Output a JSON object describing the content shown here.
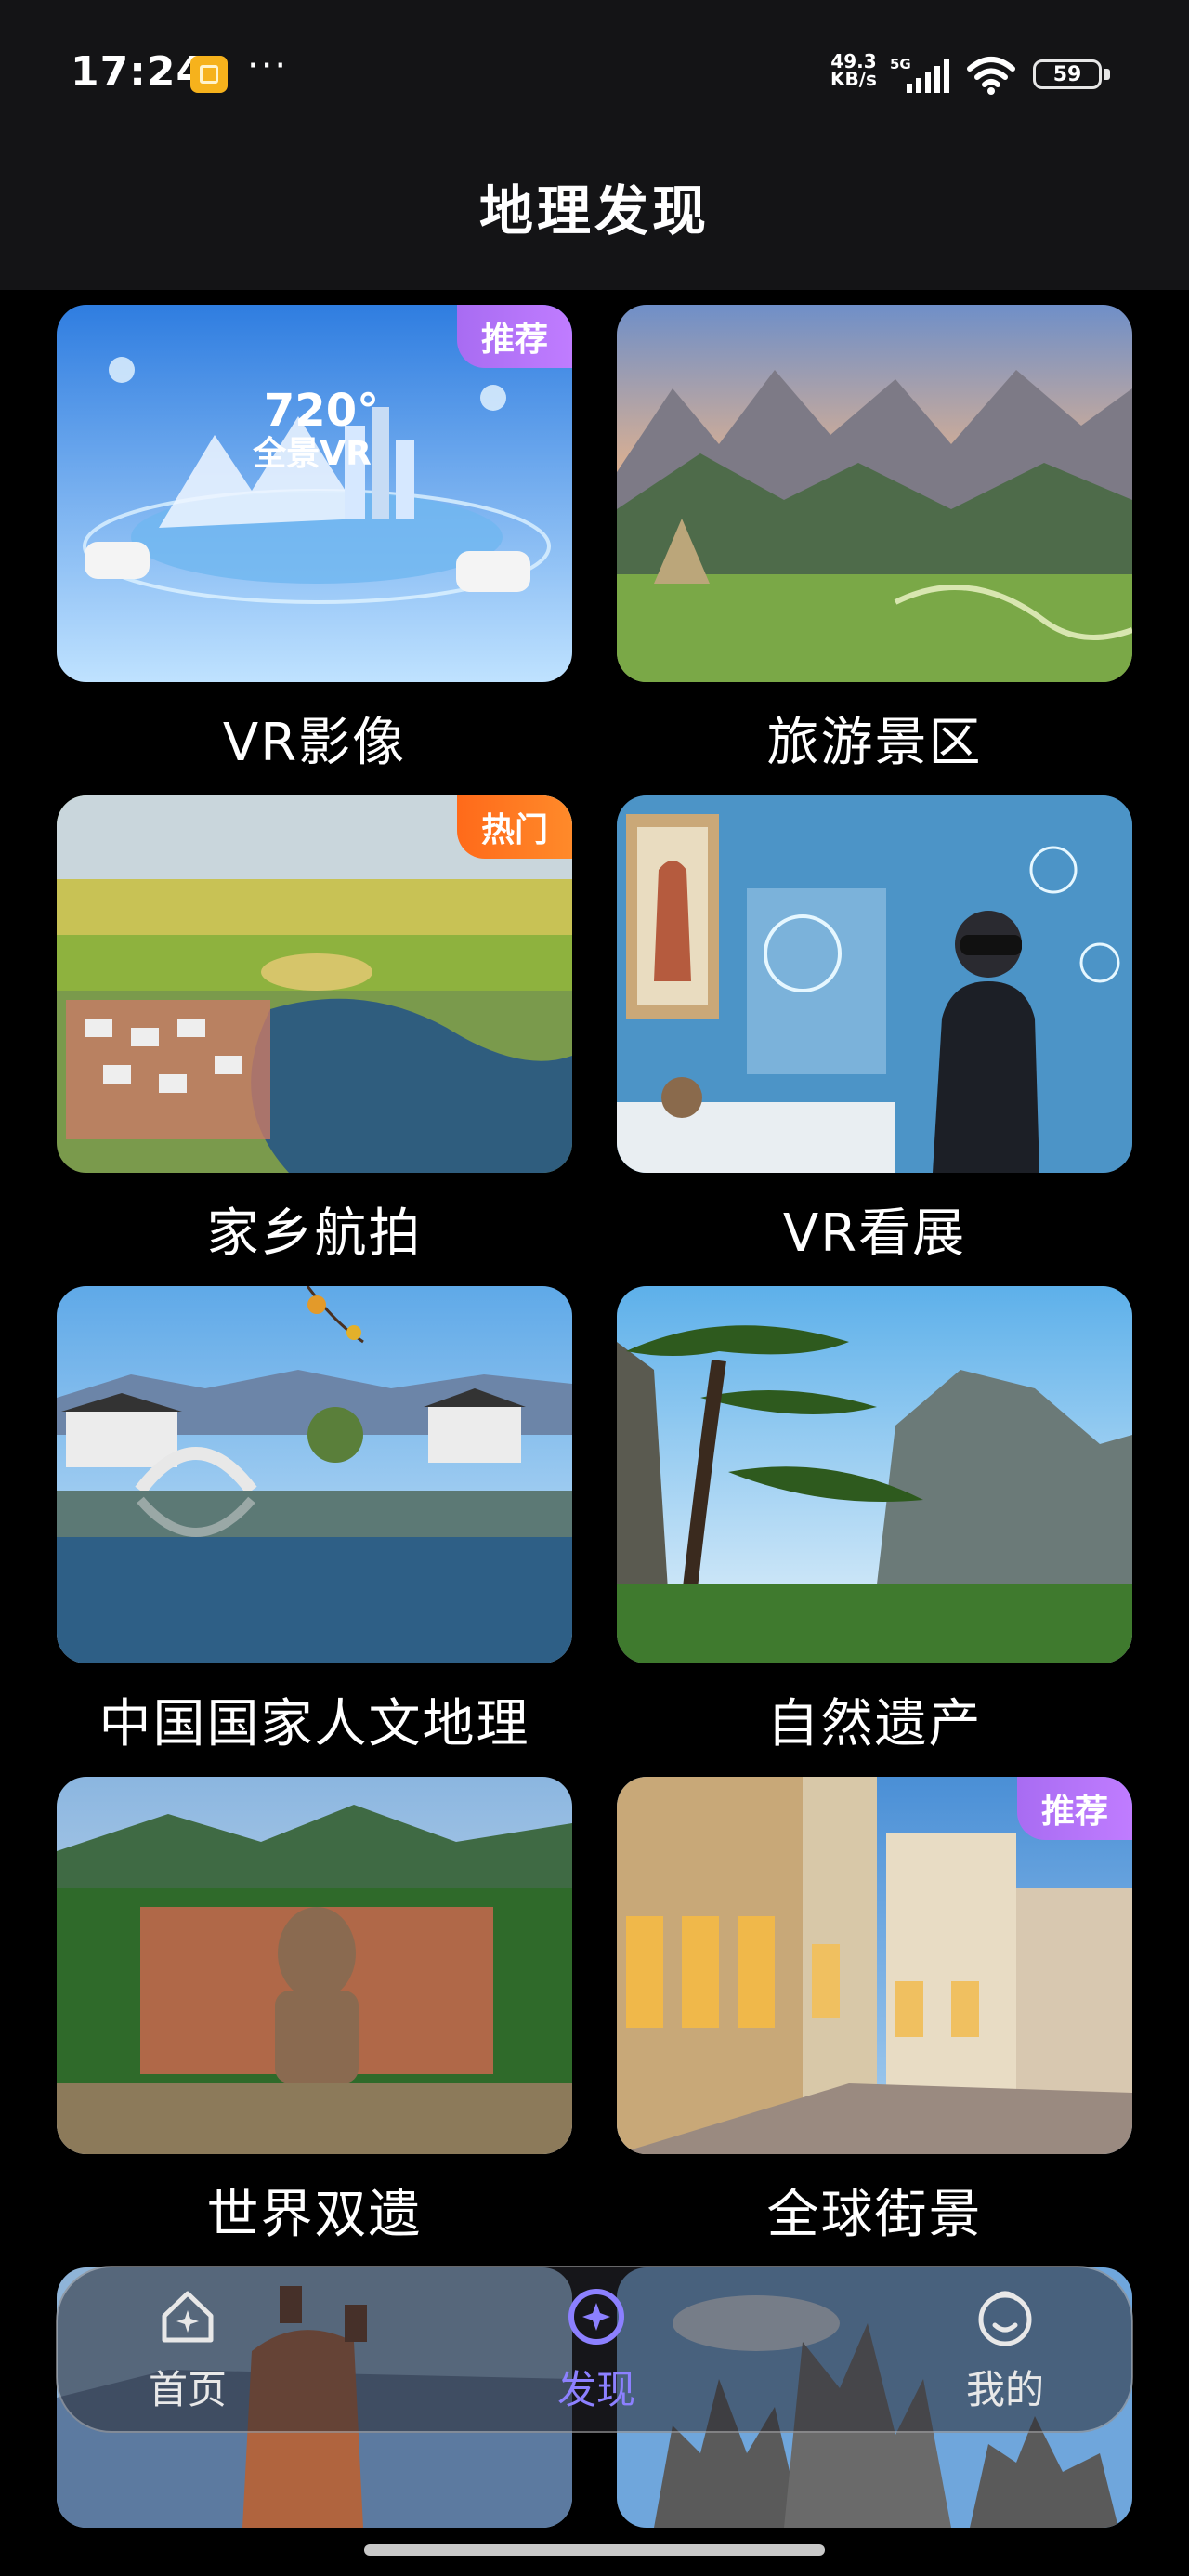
{
  "status_bar": {
    "time": "17:24",
    "more": "···",
    "net_speed_value": "49.3",
    "net_speed_unit": "KB/s",
    "network": "5G",
    "battery": "59"
  },
  "header": {
    "title": "地理发现"
  },
  "cards": [
    {
      "label": "VR影像",
      "tag": "推荐",
      "tag_type": "recommend",
      "thumb_text_top": "720°",
      "thumb_text_bottom": "全景VR"
    },
    {
      "label": "旅游景区",
      "tag": "",
      "tag_type": ""
    },
    {
      "label": "家乡航拍",
      "tag": "热门",
      "tag_type": "hot"
    },
    {
      "label": "VR看展",
      "tag": "",
      "tag_type": ""
    },
    {
      "label": "中国国家人文地理",
      "tag": "",
      "tag_type": ""
    },
    {
      "label": "自然遗产",
      "tag": "",
      "tag_type": ""
    },
    {
      "label": "世界双遗",
      "tag": "",
      "tag_type": ""
    },
    {
      "label": "全球街景",
      "tag": "推荐",
      "tag_type": "recommend"
    }
  ],
  "tabbar": {
    "items": [
      {
        "label": "首页",
        "icon": "home-icon",
        "active": false
      },
      {
        "label": "发现",
        "icon": "discover-icon",
        "active": true
      },
      {
        "label": "我的",
        "icon": "profile-icon",
        "active": false
      }
    ],
    "active_color": "#8c80ff"
  },
  "colors": {
    "header_bg": "#141416",
    "page_bg": "#000000",
    "tag_recommend": "#b274f8",
    "tag_hot": "#ff741f"
  }
}
